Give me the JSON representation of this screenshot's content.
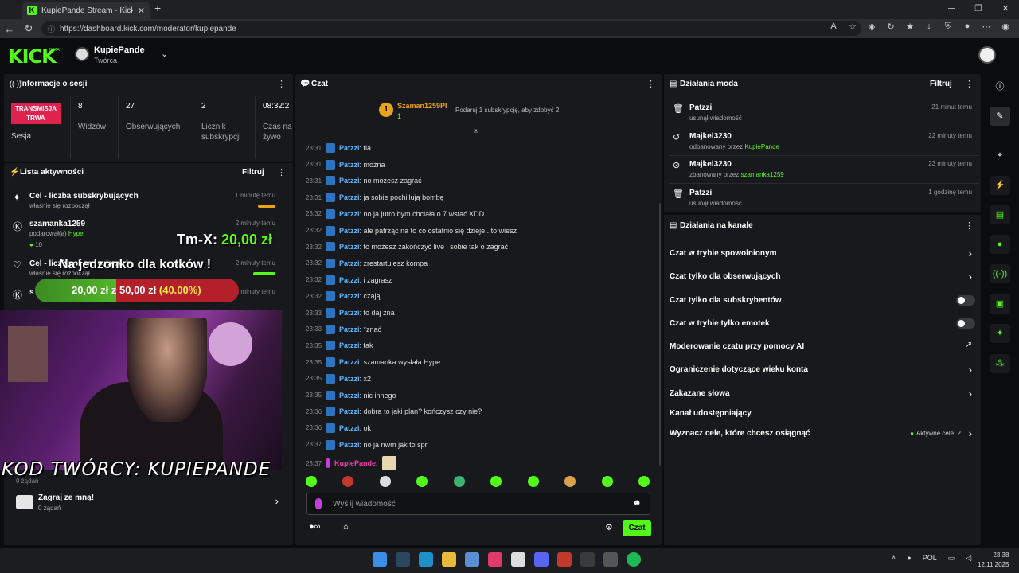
{
  "browser": {
    "tab_title": "KupiePande Stream - Kick Dashb",
    "tab_favicon": "K",
    "new_tab": "+",
    "url": "https://dashboard.kick.com/moderator/kupiepande",
    "win_min": "─",
    "win_max": "❐",
    "win_close": "✕"
  },
  "header": {
    "logo": "KICK",
    "beta": "BETA",
    "channel_name": "KupiePande",
    "channel_role": "Twórca"
  },
  "session": {
    "title": "Informacje o sesji",
    "badge": "TRANSMISJA TRWA",
    "session_label": "Sesja",
    "viewers_value": "8",
    "viewers_label": "Widzów",
    "followers_value": "27",
    "followers_label": "Obserwujących",
    "subs_value": "2",
    "subs_label": "Licznik subskrypcji",
    "time_value": "08:32:2",
    "time_label": "Czas na żywo"
  },
  "activity": {
    "title": "Lista aktywności",
    "filter": "Filtruj",
    "items": [
      {
        "title": "Cel - liczba subskrybujących",
        "sub": "właśnie się rozpoczął",
        "time": "1 minutę temu"
      },
      {
        "title": "szamanka1259",
        "sub": "podarował(a) Hype",
        "time": "2 minuty temu"
      },
      {
        "title": "Cel - liczba obserwujących",
        "sub": "właśnie się rozpoczął",
        "time": "2 minuty temu"
      },
      {
        "title": "s",
        "sub": "",
        "time": "2 minuty temu"
      }
    ],
    "coin_count": "10",
    "requests_zero": "0 żądań",
    "zagraj_title": "Zagraj ze mną!",
    "zagraj_sub": "0 żądań"
  },
  "overlay": {
    "tmx_label": "Tm-X:",
    "tmx_value": "20,00 zł",
    "goal_title": "Na jedzonko dla kotków !",
    "goal_current": "20,00 zł",
    "goal_z": "z",
    "goal_target": "50,00 zł",
    "goal_percent_text": "(40.00%)",
    "goal_percent": 0.4,
    "creator_code": "KOD TWÓRCY: KUPIEPANDE"
  },
  "chat": {
    "title": "Czat",
    "pinned_user": "Szaman1259PI",
    "pinned_coin": "1",
    "pinned_count": "1",
    "pinned_msg": "Podaruj 1 subskrypcję, aby zdobyć 2.",
    "messages": [
      {
        "time": "23:31",
        "user": "Patzzi",
        "text": ": tia"
      },
      {
        "time": "23:31",
        "user": "Patzzi",
        "text": ": można"
      },
      {
        "time": "23:31",
        "user": "Patzzi",
        "text": ": no możesz zagrać"
      },
      {
        "time": "23:31",
        "user": "Patzzi",
        "text": ": ja sobie pochillują bombę"
      },
      {
        "time": "23:32",
        "user": "Patzzi",
        "text": ": no ja jutro bym chciała o 7 wstać XDD"
      },
      {
        "time": "23:32",
        "user": "Patzzi",
        "text": ": ale patrząc na to co ostatnio się dzieje.. to wiesz"
      },
      {
        "time": "23:32",
        "user": "Patzzi",
        "text": ": to możesz zakończyć live i sobie tak o zagrać"
      },
      {
        "time": "23:32",
        "user": "Patzzi",
        "text": ": zrestartujesz kompa"
      },
      {
        "time": "23:32",
        "user": "Patzzi",
        "text": ": i zagrasz"
      },
      {
        "time": "23:32",
        "user": "Patzzi",
        "text": ": czają"
      },
      {
        "time": "23:33",
        "user": "Patzzi",
        "text": ": to daj zna"
      },
      {
        "time": "23:33",
        "user": "Patzzi",
        "text": ": *znać"
      },
      {
        "time": "23:35",
        "user": "Patzzi",
        "text": ": tak"
      },
      {
        "time": "23:35",
        "user": "Patzzi",
        "text": ": szamanka wysłała Hype"
      },
      {
        "time": "23:35",
        "user": "Patzzi",
        "text": ": x2"
      },
      {
        "time": "23:35",
        "user": "Patzzi",
        "text": ": nic innego"
      },
      {
        "time": "23:36",
        "user": "Patzzi",
        "text": ": dobra to jaki plan? kończysz czy nie?"
      },
      {
        "time": "23:36",
        "user": "Patzzi",
        "text": ": ok"
      },
      {
        "time": "23:37",
        "user": "Patzzi",
        "text": ": no ja nwm jak to spr"
      },
      {
        "time": "23:37",
        "user": "KupiePande",
        "text": ":"
      }
    ],
    "input_placeholder": "Wyślij wiadomość",
    "send_label": "Czat",
    "footer_infinity": "∞"
  },
  "mod": {
    "title": "Działania moda",
    "filter": "Filtruj",
    "rows": [
      {
        "name": "Patzzi",
        "desc": "usunął wiadomość",
        "by": "",
        "time": "21 minut temu",
        "icon": "trash-icon"
      },
      {
        "name": "Majkel3230",
        "desc": "odbanowany przez ",
        "by": "KupiePande",
        "time": "22 minuty temu",
        "icon": "undo-icon"
      },
      {
        "name": "Majkel3230",
        "desc": "zbanowany przez ",
        "by": "szamanka1259",
        "time": "23 minuty temu",
        "icon": "ban-icon"
      },
      {
        "name": "Patzzi",
        "desc": "usunął wiadomość",
        "by": "",
        "time": "1 godzinę temu",
        "icon": "trash-icon"
      }
    ]
  },
  "channel": {
    "title": "Działania na kanale",
    "rows": [
      {
        "label": "Czat w trybie spowolnionym",
        "type": "chevron"
      },
      {
        "label": "Czat tylko dla obserwujących",
        "type": "chevron"
      },
      {
        "label": "Czat tylko dla subskrybentów",
        "type": "toggle"
      },
      {
        "label": "Czat w trybie tylko emotek",
        "type": "toggle"
      },
      {
        "label": "Moderowanie czatu przy pomocy AI",
        "type": "external"
      },
      {
        "label": "Ograniczenie dotyczące wieku konta",
        "type": "chevron"
      },
      {
        "label": "Zakazane słowa",
        "type": "chevron"
      },
      {
        "label": "Kanał udostępniający",
        "type": "none"
      },
      {
        "label": "Wyznacz cele, które chcesz osiągnąć",
        "type": "chevron"
      }
    ],
    "active_goals": "Aktywne cele: 2"
  },
  "taskbar": {
    "lang": "POL",
    "time": "23:38",
    "date": "12.11.2025"
  },
  "colors": {
    "kick_green": "#53fc18",
    "live_red": "#e0234e",
    "panel": "#18191c"
  }
}
